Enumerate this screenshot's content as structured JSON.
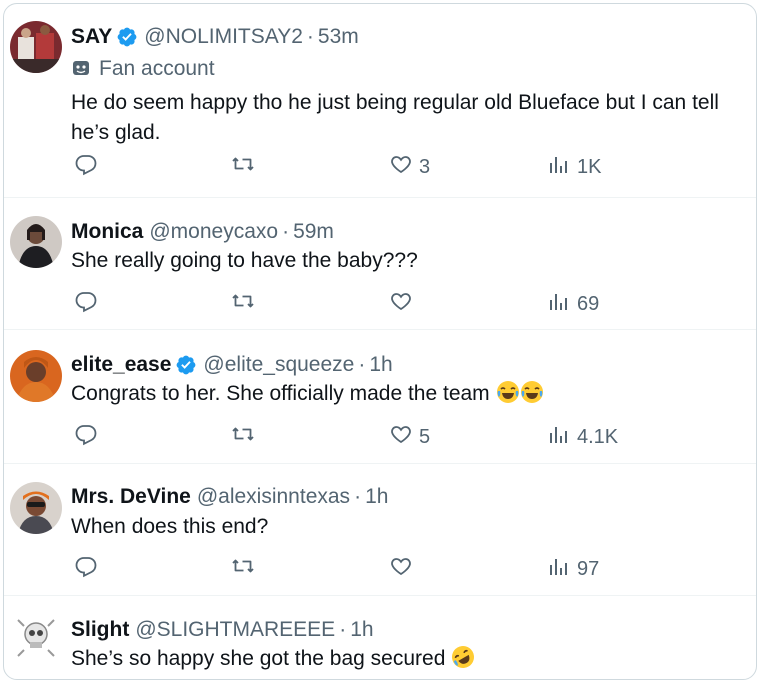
{
  "replies": [
    {
      "name": "SAY",
      "handle": "@NOLIMITSAY2",
      "time": "53m",
      "verified": true,
      "label": "Fan account",
      "text": "He do seem happy tho he just being regular old Blueface but I can tell he’s glad.",
      "likes": "3",
      "views": "1K"
    },
    {
      "name": "Monica",
      "handle": "@moneycaxo",
      "time": "59m",
      "verified": false,
      "text": "She really going to have the baby???",
      "likes": "",
      "views": "69"
    },
    {
      "name": "elite_ease",
      "handle": "@elite_squeeze",
      "time": "1h",
      "verified": true,
      "text": "Congrats to her.  She officially made the team",
      "emoji": "face-with-tears-of-joy x2",
      "likes": "5",
      "views": "4.1K"
    },
    {
      "name": "Mrs. DeVine",
      "handle": "@alexisinntexas",
      "time": "1h",
      "verified": false,
      "text": "When does this end?",
      "likes": "",
      "views": "97"
    },
    {
      "name": "Slight",
      "handle": "@SLIGHTMAREEEE",
      "time": "1h",
      "verified": false,
      "text": "She’s so happy she got the bag secured",
      "emoji": "rolling-on-the-floor-laughing"
    }
  ],
  "dot": "·",
  "colors": {
    "verified": "#1d9bf0",
    "muted": "#536471",
    "text": "#0f1419",
    "divider": "#eff3f4"
  }
}
